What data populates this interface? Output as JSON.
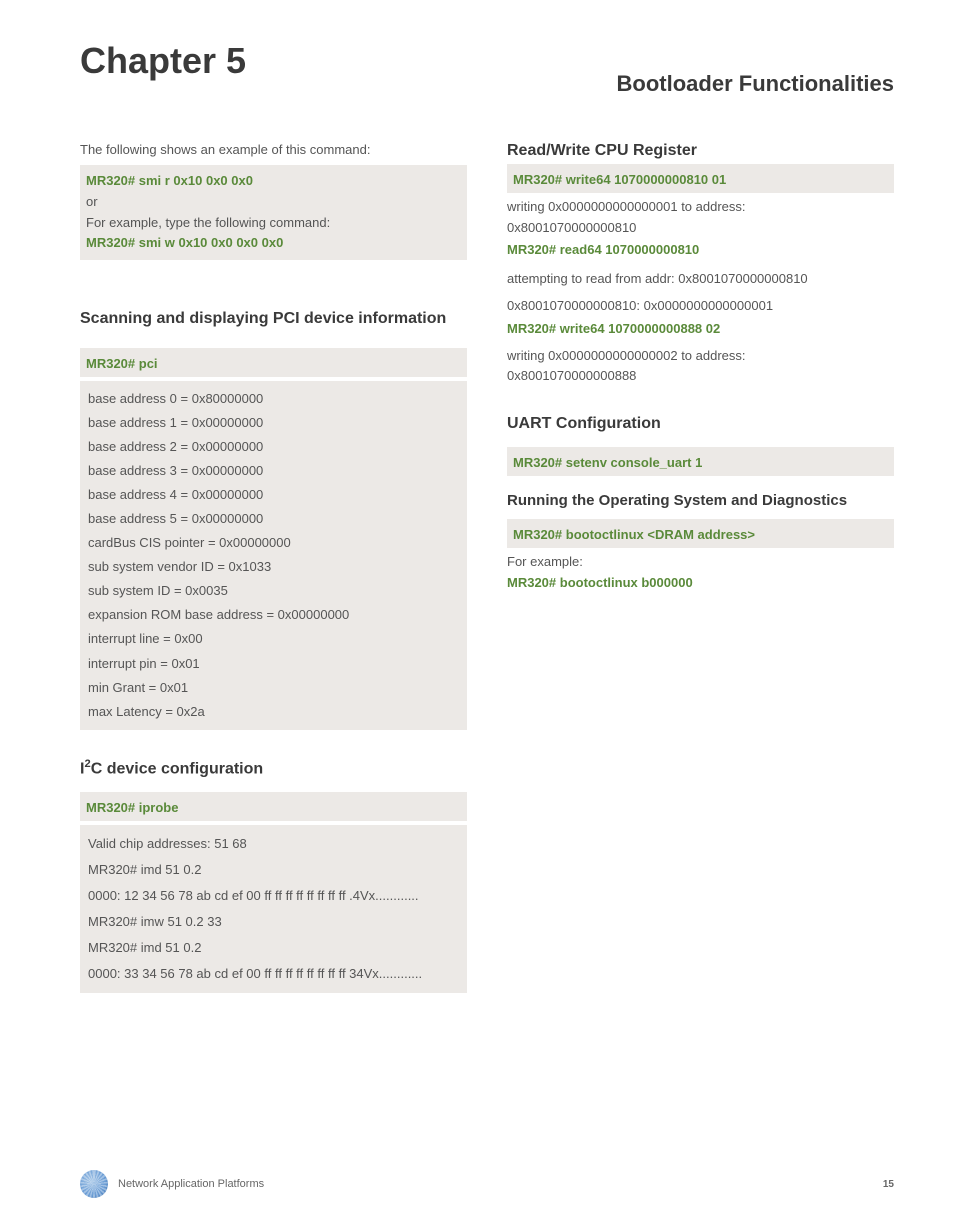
{
  "header": {
    "chapter": "Chapter 5",
    "subtitle": "Bootloader Functionalities"
  },
  "left": {
    "intro": "The following shows an example of this command:",
    "cmd1": "MR320# smi r 0x10 0x0 0x0",
    "or": "or",
    "for_example": "For example, type  the following command:",
    "cmd2": "MR320# smi w 0x10 0x0 0x0 0x0",
    "scan_heading": "Scanning and displaying PCI device information",
    "pci_cmd": "MR320# pci",
    "pci_lines": [
      "base address 0 = 0x80000000",
      "base address 1 = 0x00000000",
      "base address 2 = 0x00000000",
      "base address 3 = 0x00000000",
      "base address 4 = 0x00000000",
      "base address 5 = 0x00000000",
      "cardBus CIS pointer = 0x00000000",
      "sub system vendor ID = 0x1033",
      "sub system ID = 0x0035",
      "expansion ROM base address = 0x00000000",
      "interrupt line = 0x00",
      "interrupt pin = 0x01",
      "min Grant = 0x01",
      "max Latency = 0x2a"
    ],
    "i2c_heading_pre": "I",
    "i2c_heading_sup": "2",
    "i2c_heading_post": "C device configuration",
    "iprobe_cmd": "MR320# iprobe",
    "i2c_lines": [
      "Valid chip addresses: 51 68",
      "MR320# imd 51 0.2",
      "0000: 12 34 56 78 ab cd ef 00 ff ff ff ff ff ff ff ff .4Vx............",
      "MR320# imw 51 0.2 33",
      "MR320# imd 51 0.2",
      "0000: 33 34 56 78 ab cd ef 00 ff ff ff ff ff ff ff ff 34Vx............"
    ]
  },
  "right": {
    "rw_heading": "Read/Write CPU Register",
    "rw_cmd1": "MR320# write64 1070000000810 01",
    "rw_line1a": "writing 0x0000000000000001 to address:",
    "rw_line1b": "0x8001070000000810",
    "rw_cmd2": "MR320# read64 1070000000810",
    "rw_line2": "attempting to read from addr: 0x8001070000000810",
    "rw_line3": "0x8001070000000810: 0x0000000000000001",
    "rw_cmd3": "MR320# write64 1070000000888 02",
    "rw_line4a": "writing 0x0000000000000002 to address:",
    "rw_line4b": "0x8001070000000888",
    "uart_heading": "UART Configuration",
    "uart_cmd": "MR320# setenv console_uart 1",
    "run_heading": "Running the Operating System and Diagnostics",
    "run_cmd": "MR320# bootoctlinux <DRAM address>",
    "run_fe": "For example:",
    "run_cmd2": "MR320# bootoctlinux b000000"
  },
  "footer": {
    "text": "Network Application Platforms",
    "page": "15"
  }
}
